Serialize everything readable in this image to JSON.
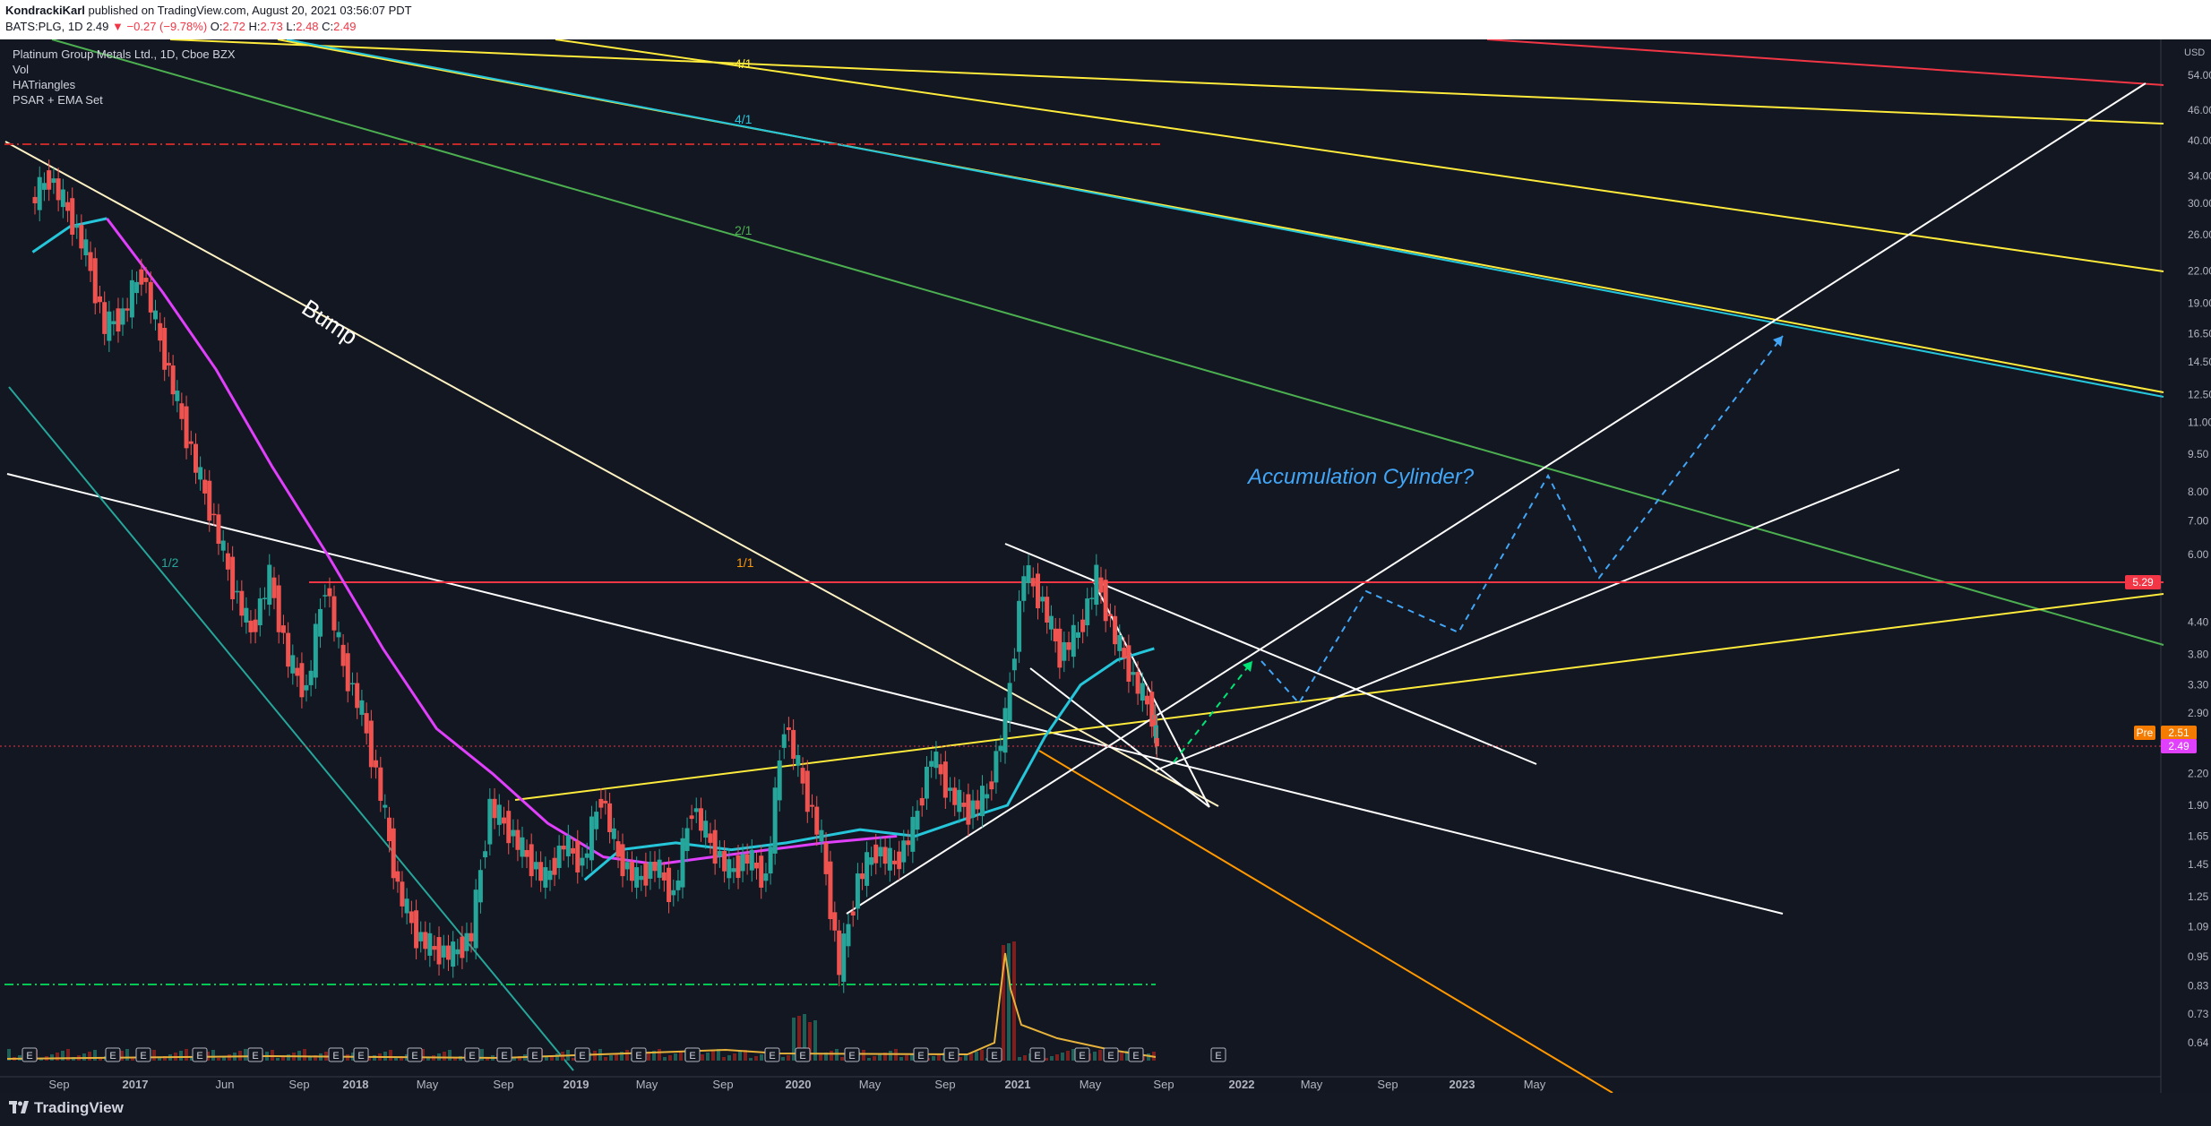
{
  "header": {
    "author": "KondrackiKarl",
    "published": "published on TradingView.com, August 20, 2021 03:56:07 PDT",
    "symbol": "BATS:PLG, 1D",
    "price": "2.49",
    "change": "−0.27 (−9.78%)",
    "ohlc": [
      {
        "k": "O:",
        "v": "2.72"
      },
      {
        "k": "H:",
        "v": "2.73"
      },
      {
        "k": "L:",
        "v": "2.48"
      },
      {
        "k": "C:",
        "v": "2.49"
      }
    ]
  },
  "legend": {
    "title": "Platinum Group Metals Ltd., 1D, Cboe BZX",
    "indicators": [
      "Vol",
      "HATriangles",
      "PSAR + EMA Set"
    ]
  },
  "footer": {
    "brand": "TradingView"
  },
  "chart_data": {
    "type": "line",
    "title": "Platinum Group Metals Ltd., 1D, Cboe BZX",
    "ylabel": "USD",
    "yscale": "log",
    "ylim": [
      0.58,
      63
    ],
    "y_ticks": [
      54.0,
      46.0,
      40.0,
      34.0,
      30.0,
      26.0,
      22.0,
      19.0,
      16.5,
      14.5,
      12.5,
      11.0,
      9.5,
      8.0,
      7.0,
      6.0,
      5.29,
      4.4,
      3.8,
      3.3,
      2.9,
      2.51,
      2.49,
      2.2,
      1.9,
      1.65,
      1.45,
      1.25,
      1.09,
      0.95,
      0.83,
      0.73,
      0.64
    ],
    "x_ticks": [
      "Sep",
      "2017",
      "Jun",
      "Sep",
      "2018",
      "May",
      "Sep",
      "2019",
      "May",
      "Sep",
      "2020",
      "May",
      "Sep",
      "2021",
      "May",
      "Sep",
      "2022",
      "May",
      "Sep",
      "2023",
      "May"
    ],
    "price_badges": [
      {
        "label": "5.29",
        "color": "#f23645"
      },
      {
        "label": "Pre",
        "color": "#f57c00"
      },
      {
        "label": "2.51",
        "color": "#f57c00"
      },
      {
        "label": "2.49",
        "color": "#e040fb"
      }
    ],
    "annotations": [
      {
        "text": "Bump",
        "color": "#ffffff"
      },
      {
        "text": "Accumulation Cylinder?",
        "color": "#42a5f5"
      },
      {
        "text": "4/1",
        "color": "#ffeb3b"
      },
      {
        "text": "4/1",
        "color": "#26c6da"
      },
      {
        "text": "2/1",
        "color": "#4caf50"
      },
      {
        "text": "1/1",
        "color": "#ff9800"
      },
      {
        "text": "1/2",
        "color": "#26a69a"
      }
    ],
    "earnings_markers": [
      "E",
      "E",
      "E",
      "E",
      "E",
      "E",
      "E",
      "E",
      "E",
      "E",
      "E",
      "E",
      "E",
      "E",
      "E",
      "E",
      "E",
      "E",
      "E",
      "E",
      "E",
      "E",
      "E",
      "E",
      "E",
      "E"
    ],
    "series": [
      {
        "name": "Vol",
        "color": "#e6b23b"
      },
      {
        "name": "PSAR + EMA Set",
        "color": "#e040fb"
      }
    ],
    "price_path": [
      {
        "x": "2016-07",
        "y": 30
      },
      {
        "x": "2016-08",
        "y": 34
      },
      {
        "x": "2016-09",
        "y": 29
      },
      {
        "x": "2016-10",
        "y": 24
      },
      {
        "x": "2016-11",
        "y": 17
      },
      {
        "x": "2016-12",
        "y": 18
      },
      {
        "x": "2017-01",
        "y": 22
      },
      {
        "x": "2017-02",
        "y": 16
      },
      {
        "x": "2017-03",
        "y": 12
      },
      {
        "x": "2017-04",
        "y": 9
      },
      {
        "x": "2017-05",
        "y": 7
      },
      {
        "x": "2017-06",
        "y": 5.2
      },
      {
        "x": "2017-07",
        "y": 4.2
      },
      {
        "x": "2017-08",
        "y": 5.4
      },
      {
        "x": "2017-09",
        "y": 3.7
      },
      {
        "x": "2017-10",
        "y": 3.2
      },
      {
        "x": "2017-11",
        "y": 5.3
      },
      {
        "x": "2017-12",
        "y": 3.6
      },
      {
        "x": "2018-01",
        "y": 2.9
      },
      {
        "x": "2018-02",
        "y": 2.0
      },
      {
        "x": "2018-03",
        "y": 1.3
      },
      {
        "x": "2018-04",
        "y": 1.05
      },
      {
        "x": "2018-05",
        "y": 0.98
      },
      {
        "x": "2018-06",
        "y": 0.96
      },
      {
        "x": "2018-07",
        "y": 1.05
      },
      {
        "x": "2018-08",
        "y": 1.9
      },
      {
        "x": "2018-09",
        "y": 1.7
      },
      {
        "x": "2018-10",
        "y": 1.5
      },
      {
        "x": "2018-11",
        "y": 1.35
      },
      {
        "x": "2018-12",
        "y": 1.6
      },
      {
        "x": "2019-01",
        "y": 1.45
      },
      {
        "x": "2019-02",
        "y": 2.0
      },
      {
        "x": "2019-03",
        "y": 1.5
      },
      {
        "x": "2019-04",
        "y": 1.35
      },
      {
        "x": "2019-05",
        "y": 1.45
      },
      {
        "x": "2019-06",
        "y": 1.25
      },
      {
        "x": "2019-07",
        "y": 1.9
      },
      {
        "x": "2019-08",
        "y": 1.6
      },
      {
        "x": "2019-09",
        "y": 1.4
      },
      {
        "x": "2019-10",
        "y": 1.5
      },
      {
        "x": "2019-11",
        "y": 1.35
      },
      {
        "x": "2019-12",
        "y": 2.8
      },
      {
        "x": "2020-01",
        "y": 2.1
      },
      {
        "x": "2020-02",
        "y": 1.6
      },
      {
        "x": "2020-03",
        "y": 0.9
      },
      {
        "x": "2020-04",
        "y": 1.35
      },
      {
        "x": "2020-05",
        "y": 1.55
      },
      {
        "x": "2020-06",
        "y": 1.45
      },
      {
        "x": "2020-07",
        "y": 1.7
      },
      {
        "x": "2020-08",
        "y": 2.4
      },
      {
        "x": "2020-09",
        "y": 2.0
      },
      {
        "x": "2020-10",
        "y": 1.85
      },
      {
        "x": "2020-11",
        "y": 2.0
      },
      {
        "x": "2020-12",
        "y": 2.8
      },
      {
        "x": "2021-01",
        "y": 5.6
      },
      {
        "x": "2021-02",
        "y": 4.8
      },
      {
        "x": "2021-03",
        "y": 3.8
      },
      {
        "x": "2021-04",
        "y": 4.2
      },
      {
        "x": "2021-05",
        "y": 5.4
      },
      {
        "x": "2021-06",
        "y": 4.1
      },
      {
        "x": "2021-07",
        "y": 3.4
      },
      {
        "x": "2021-08",
        "y": 2.9
      },
      {
        "x": "2021-08-20",
        "y": 2.49
      }
    ],
    "ema_cyan": [
      {
        "x": "2016-07",
        "y": 24
      },
      {
        "x": "2016-09",
        "y": 27
      },
      {
        "x": "2016-11",
        "y": 28
      }
    ],
    "ema_cyan_2": [
      {
        "x": "2019-01",
        "y": 1.35
      },
      {
        "x": "2019-03",
        "y": 1.55
      },
      {
        "x": "2019-06",
        "y": 1.6
      },
      {
        "x": "2019-09",
        "y": 1.55
      },
      {
        "x": "2019-12",
        "y": 1.6
      },
      {
        "x": "2020-04",
        "y": 1.7
      },
      {
        "x": "2020-07",
        "y": 1.65
      },
      {
        "x": "2020-10",
        "y": 1.8
      },
      {
        "x": "2020-12",
        "y": 1.9
      },
      {
        "x": "2021-02",
        "y": 2.6
      },
      {
        "x": "2021-04",
        "y": 3.3
      },
      {
        "x": "2021-06",
        "y": 3.7
      },
      {
        "x": "2021-08",
        "y": 3.9
      }
    ],
    "ema_magenta": [
      {
        "x": "2016-11",
        "y": 28
      },
      {
        "x": "2017-02",
        "y": 20
      },
      {
        "x": "2017-05",
        "y": 14
      },
      {
        "x": "2017-08",
        "y": 9
      },
      {
        "x": "2017-11",
        "y": 6
      },
      {
        "x": "2018-02",
        "y": 3.9
      },
      {
        "x": "2018-05",
        "y": 2.7
      },
      {
        "x": "2018-08",
        "y": 2.2
      },
      {
        "x": "2018-11",
        "y": 1.75
      },
      {
        "x": "2019-02",
        "y": 1.5
      },
      {
        "x": "2019-05",
        "y": 1.45
      },
      {
        "x": "2019-08",
        "y": 1.5
      },
      {
        "x": "2019-11",
        "y": 1.55
      },
      {
        "x": "2020-02",
        "y": 1.6
      },
      {
        "x": "2020-06",
        "y": 1.65
      }
    ]
  }
}
